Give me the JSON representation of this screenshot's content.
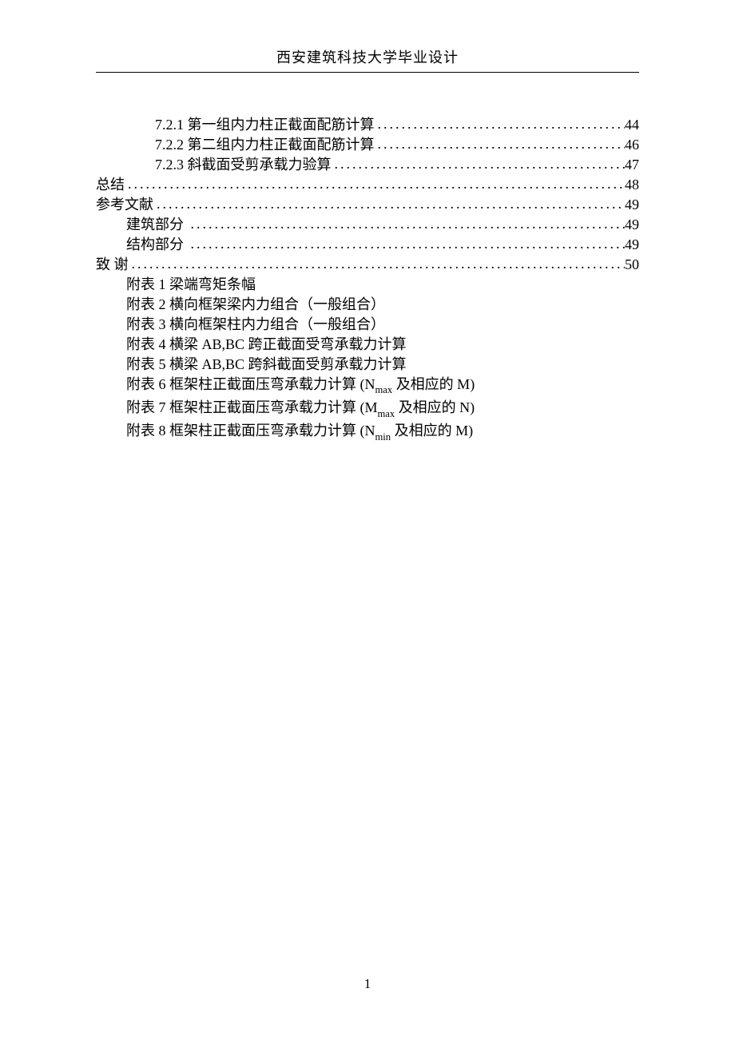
{
  "header": "西安建筑科技大学毕业设计",
  "page_number": "1",
  "toc": [
    {
      "indent": 2,
      "label": "7.2.1 第一组内力柱正截面配筋计算",
      "page": "44"
    },
    {
      "indent": 2,
      "label": "7.2.2 第二组内力柱正截面配筋计算",
      "page": "46"
    },
    {
      "indent": 2,
      "label": "7.2.3 斜截面受剪承载力验算",
      "page": "47"
    },
    {
      "indent": 0,
      "label": "总结",
      "page": "48"
    },
    {
      "indent": 0,
      "label": "参考文献",
      "page": "49"
    },
    {
      "indent": 1,
      "label": "建筑部分",
      "page": "49",
      "trailing_space": true
    },
    {
      "indent": 1,
      "label": "结构部分",
      "page": "49",
      "trailing_space": true
    },
    {
      "indent": 0,
      "label": "致 谢",
      "page": "50",
      "spaced": true
    }
  ],
  "appendix": [
    {
      "prefix": "附表 1 ",
      "text": "梁端弯矩条幅"
    },
    {
      "prefix": "附表 2 ",
      "text": "横向框架梁内力组合（一般组合）"
    },
    {
      "prefix": "附表 3 ",
      "text": "横向框架柱内力组合（一般组合）"
    },
    {
      "prefix": "附表 4 ",
      "text": "横梁 AB,BC 跨正截面受弯承载力计算"
    },
    {
      "prefix": "附表 5 ",
      "text": "横梁 AB,BC 跨斜截面受剪承载力计算"
    },
    {
      "prefix": "附表 6 ",
      "text_html": "框架柱正截面压弯承载力计算 (N<sub>max</sub> 及相应的 M)",
      "text_plain": "框架柱正截面压弯承载力计算 (Nmax 及相应的 M)"
    },
    {
      "prefix": "附表 7 ",
      "text_html": "框架柱正截面压弯承载力计算 (M<sub>max</sub>  及相应的 N)",
      "text_plain": "框架柱正截面压弯承载力计算 (Mmax  及相应的 N)"
    },
    {
      "prefix": "附表 8 ",
      "text_html": "框架柱正截面压弯承载力计算 (N<sub>min</sub> 及相应的 M)",
      "text_plain": "框架柱正截面压弯承载力计算 (Nmin 及相应的 M)"
    }
  ]
}
